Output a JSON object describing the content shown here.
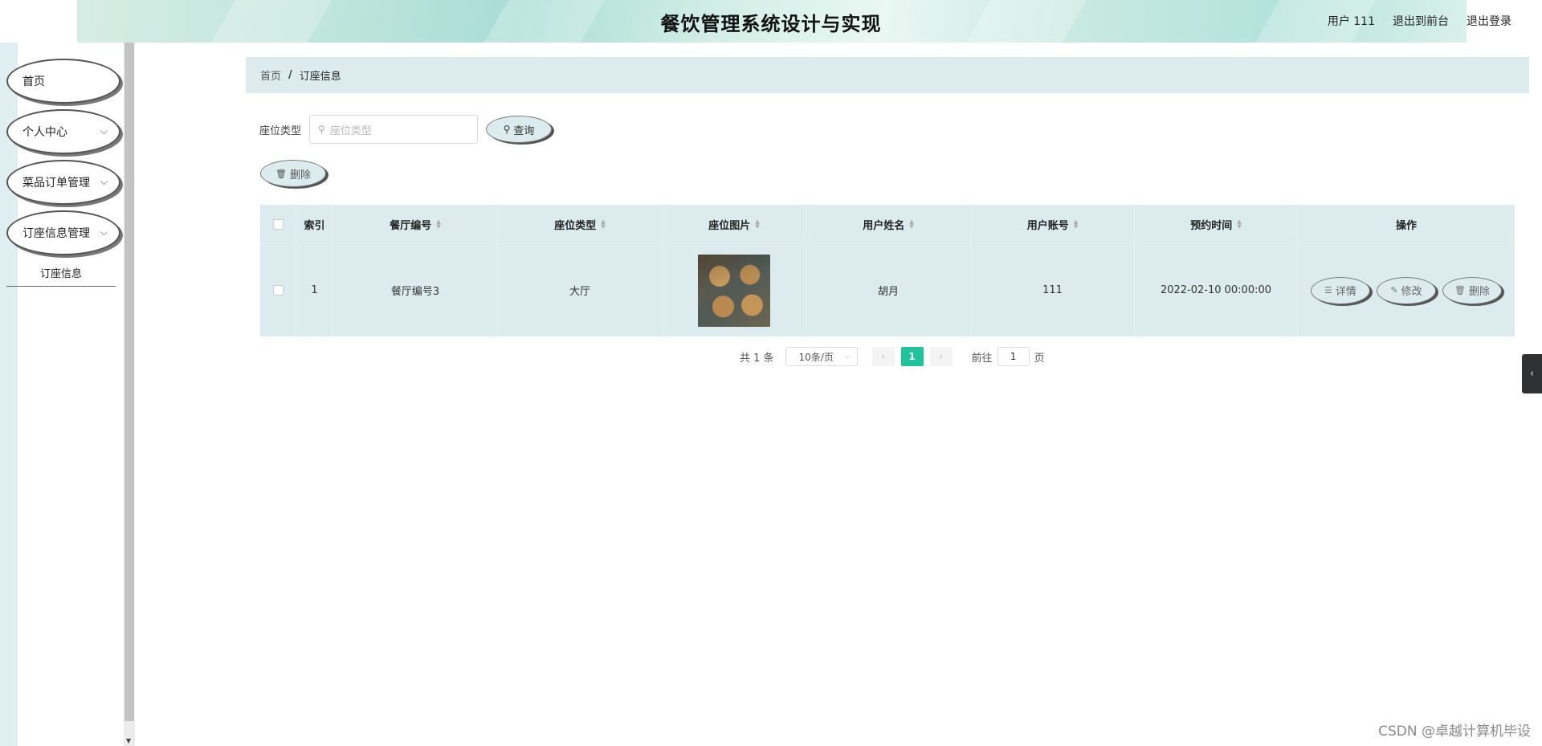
{
  "header": {
    "title": "餐饮管理系统设计与实现",
    "user_label": "用户 111",
    "back_front_label": "退出到前台",
    "logout_label": "退出登录"
  },
  "sidebar": {
    "items": [
      {
        "label": "首页"
      },
      {
        "label": "个人中心"
      },
      {
        "label": "菜品订单管理"
      },
      {
        "label": "订座信息管理"
      }
    ],
    "submenu_active": "订座信息"
  },
  "breadcrumb": {
    "home": "首页",
    "separator": "/",
    "current": "订座信息"
  },
  "search": {
    "label": "座位类型",
    "placeholder": "座位类型",
    "query_label": "查询"
  },
  "toolbar": {
    "delete_label": "删除"
  },
  "table": {
    "headers": [
      "索引",
      "餐厅编号",
      "座位类型",
      "座位图片",
      "用户姓名",
      "用户账号",
      "预约时间",
      "操作"
    ],
    "rows": [
      {
        "index": "1",
        "restaurant_no": "餐厅编号3",
        "seat_type": "大厅",
        "user_name": "胡月",
        "user_account": "111",
        "reserve_time": "2022-02-10 00:00:00"
      }
    ],
    "actions": {
      "detail": "详情",
      "edit": "修改",
      "delete": "删除"
    }
  },
  "pagination": {
    "total": "共 1 条",
    "page_size": "10条/页",
    "current_page": "1",
    "goto_prefix": "前往",
    "goto_value": "1",
    "goto_suffix": "页"
  },
  "watermark": "CSDN @卓越计算机毕设",
  "colors": {
    "accent": "#21c39a",
    "table_bg": "#dcecee",
    "edge_tab": "#303133"
  }
}
